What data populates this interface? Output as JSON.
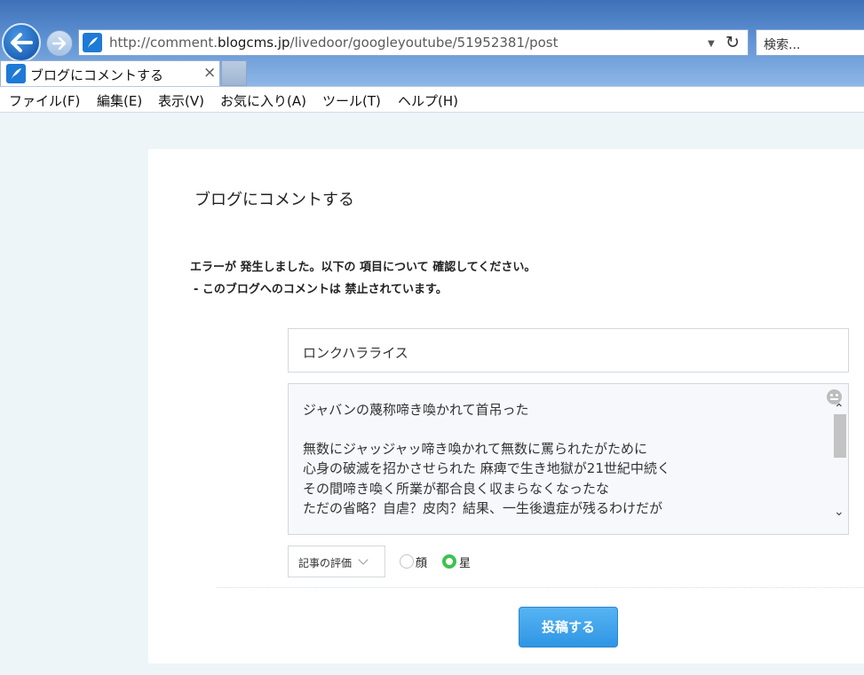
{
  "browser": {
    "url_prefix": "http://comment.",
    "url_domain": "blogcms.jp",
    "url_path": "/livedoor/googleyoutube/51952381/post",
    "search_placeholder": "検索...",
    "tab_title": "ブログにコメントする",
    "tab_close": "×",
    "refresh_glyph": "↻",
    "dropdown_glyph": "▼"
  },
  "menu": {
    "items": [
      "ファイル(F)",
      "編集(E)",
      "表示(V)",
      "お気に入り(A)",
      "ツール(T)",
      "ヘルプ(H)"
    ]
  },
  "page": {
    "title": "ブログにコメントする",
    "error_line1": "エラーが 発生しました。以下の 項目について 確認してください。",
    "error_line2": "- このブログへのコメントは 禁止されています。",
    "name_value": "ロンクハラライス",
    "comment_lines": [
      "ジャバンの蔑称啼き喚かれて首吊った",
      "",
      "無数にジャッジャッ啼き喚かれて無数に罵られたがために",
      "心身の破滅を招かさせられた  麻痺で生き地獄が21世紀中続く",
      "その間啼き喚く所業が都合良く収まらなくなったな",
      "ただの省略？自虐？皮肉？結果、一生後遺症が残るわけだが"
    ],
    "rating_select": "記事の評価",
    "radio_face": "顔",
    "radio_star": "星",
    "radio_selected": "星",
    "submit_label": "投稿する"
  },
  "colors": {
    "chrome_blue": "#4f86cc",
    "accent_green": "#3cc24f",
    "submit_blue": "#3fa3ec",
    "page_background": "#eef5f9"
  },
  "icons": [
    "back-arrow-icon",
    "forward-arrow-icon",
    "site-feather-icon",
    "refresh-icon",
    "dropdown-icon",
    "close-icon",
    "emoji-icon",
    "chevron-down-icon",
    "scroll-up-icon",
    "scroll-down-icon"
  ]
}
